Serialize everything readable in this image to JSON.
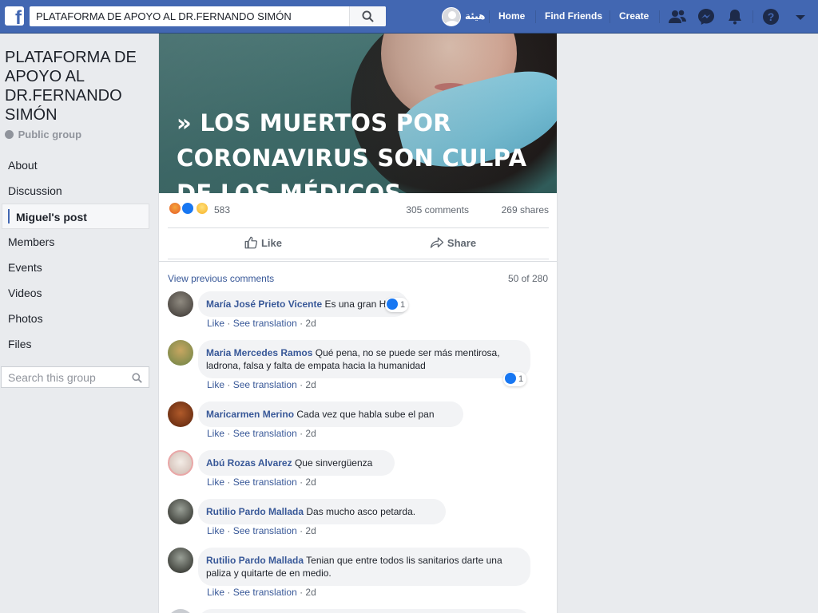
{
  "topbar": {
    "search_value": "PLATAFORMA DE APOYO AL DR.FERNANDO SIMÓN",
    "user_name": "هيئة",
    "nav": [
      "Home",
      "Find Friends",
      "Create"
    ],
    "colors": {
      "bar": "#4267b2",
      "link": "#385898"
    }
  },
  "sidebar": {
    "group_title": "PLATAFORMA DE APOYO AL DR.FERNANDO SIMÓN",
    "privacy": "Public group",
    "items": [
      "About",
      "Discussion",
      "Miguel's post",
      "Members",
      "Events",
      "Videos",
      "Photos",
      "Files"
    ],
    "active_item": "Miguel's post",
    "search_placeholder": "Search this group"
  },
  "post": {
    "image_text": "» LOS MUERTOS POR CORONAVIRUS SON CULPA DE LOS MÉDICOS",
    "reactions": {
      "icons": [
        "angry-icon",
        "like-icon",
        "haha-icon"
      ],
      "count": "583"
    },
    "comments_count": "305 comments",
    "shares_count": "269 shares",
    "actions": {
      "like": "Like",
      "share": "Share"
    }
  },
  "comments": {
    "view_previous": "View previous comments",
    "counter": "50 of 280",
    "meta": {
      "like": "Like",
      "translate": "See translation",
      "time": "2d"
    },
    "items": [
      {
        "name": "María José Prieto Vicente",
        "text": "Es una gran HP",
        "reaction_count": "1"
      },
      {
        "name": "Maria Mercedes Ramos",
        "text": "Qué pena, no se puede ser más mentirosa, ladrona, falsa y falta de empata hacia la humanidad",
        "reaction_count": "1"
      },
      {
        "name": "Maricarmen Merino",
        "text": "Cada vez que habla sube el pan",
        "reaction_count": ""
      },
      {
        "name": "Abú Rozas Alvarez",
        "text": "Que sinvergüenza",
        "reaction_count": ""
      },
      {
        "name": "Rutilio Pardo Mallada",
        "text": "Das mucho asco petarda.",
        "reaction_count": ""
      },
      {
        "name": "Rutilio Pardo Mallada",
        "text": "Tenian que entre todos lis sanitarios darte una paliza y quitarte de en medio.",
        "reaction_count": ""
      }
    ]
  }
}
